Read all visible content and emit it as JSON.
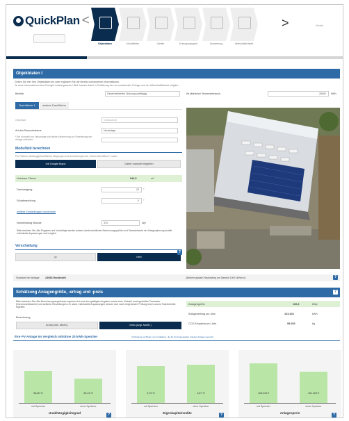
{
  "header": {
    "logo_bold": "QuickPlan",
    "logo_chevron": "<",
    "button_label": "",
    "steps": [
      {
        "label": "Objektdaten",
        "icon": "house-icon",
        "active": true
      },
      {
        "label": "Modulfelder",
        "icon": "roof-icon",
        "active": false
      },
      {
        "label": "Geräte",
        "icon": "calculator-icon",
        "active": false
      },
      {
        "label": "Erzeugungsgrad",
        "icon": "inverter-icon",
        "active": false
      },
      {
        "label": "Auswertung",
        "icon": "percent-icon",
        "active": false
      },
      {
        "label": "Wirtschaftlichkeit",
        "icon": "euro-icon",
        "active": false
      }
    ],
    "next_arrow": ">",
    "menu_text": "Weiter",
    "progress_fraction": 0.24
  },
  "objekt": {
    "title": "Objektdaten I",
    "intro_1": "Geben Sie hier Ihre Objektdaten ein oder ergänzen Sie die bereits vorhandenen Informationen.",
    "intro_2": "Ja ohne Informationen sind Energie-Leistungswerte / Bild- basiert dabei in Schätzung des zu erwartenden Ertrags und der Wirtschaftlichkeit möglich.",
    "betrieb_label": "Betrieb",
    "betrieb_value": "Gewerbebetrieb, Nutzung zweitägig",
    "verbrauch_label": "Ihr jährlicher Stromverbrauch",
    "verbrauch_value": "25000",
    "verbrauch_unit": "kWh",
    "tab_active": "Dachfläche 1",
    "tab_other": "weitere Dachfläche",
    "field_1_label": "Objektart",
    "field_1_value": "Gebäudeart",
    "field_2_label": "Art des Bauvorhabens",
    "field_2_value": "Neuanlage",
    "field_2_hint": "* Bei Auswahl von Neuanlage sind keine Abrechnung zur Erweiterung der Anlage enthalten",
    "modulfeld_title": "Modulfeld berechnen",
    "modulfeld_hint": "Für Flächen (abhängig/Dachfläche) Neigungen und Ausrichtungen der \"ersten Dachfläche\" nutzen",
    "btn_google": "mit Google Maps",
    "btn_manual": "Daten manuell eingeben",
    "nutzbare_label": "Nutzbare Fläche",
    "nutzbare_value": "543,5",
    "nutzbare_unit": "m²",
    "dachneigung_label": "Dachneigung",
    "dachneigung_value": "20",
    "dachneigung_unit": "°",
    "ausrichtung_label": "Südabweichung",
    "ausrichtung_value": "0",
    "ausrichtung_unit": "°",
    "link_advanced": "weitere Einstellungen vornehmen",
    "leistung_label": "Nennleistung Module",
    "leistung_value": "370",
    "leistung_unit": "Wp",
    "note": "Bitte beachten Sie: Alle Eingaben und Vorschläge werden anhand durchschnittlicher Berechnungsgrößen und Standardwerte der Anlagenplanung erstellt. Individuelle Anpassungen sind möglich.",
    "verschattung_title": "Verschattung",
    "vs_option_1": "ja",
    "vs_option_2": "nein",
    "standort_label": "Standort der Anlage",
    "standort_value": "24983 Handewitt",
    "standort_right": "Jährliche globale Einstrahlung am Standort 1000 kWh/m²/a"
  },
  "schaetzung": {
    "title": "Schätzung Anlagengröße, -ertrag und -preis",
    "text": "Bitte beachten Sie: Alle Berechnungsergebnisse ergeben sich aus den getätigten Angaben sowie einer Vielzahl voreingestellter Parameter (Durchschnittswerte) und weiteren Einstellungen z.B. stark. Individuelle Anpassungen können sich nach eingehender Prüfung durch unsere Fachbetriebe ergeben.",
    "berechnung_label": "Berechnung",
    "btn_1": "brutto (inkl. MwSt.)",
    "btn_2": "netto (zzgl. MwSt.)",
    "results": [
      {
        "label": "Anlagengröße",
        "value": "106,3",
        "unit": "kWp"
      },
      {
        "label": "Anlagenertrag pro Jahr",
        "value": "103.343",
        "unit": "kWh"
      },
      {
        "label": "CO2-Ersparnis pro Jahr",
        "value": "55.053",
        "unit": "kg"
      }
    ]
  },
  "vergleich": {
    "title": "Ihre PV-Anlage im Vergleich mit/ohne 20 kWh-Speicher",
    "subtitle": "(Vorhaltung auf Basis vom Installation, die für Sie freigestellten Anteilen Anlagen genutzt)",
    "panels": [
      {
        "title": "Unabhängigkeitsgrad",
        "bars": [
          {
            "label": "mit Speicher",
            "value": "65,80 %",
            "h": 0.75
          },
          {
            "label": "ohne Speicher",
            "value": "50,14 %",
            "h": 0.57
          }
        ]
      },
      {
        "title": "Eigenkapitalrendite",
        "bars": [
          {
            "label": "mit Speicher",
            "value": "3,75 %",
            "h": 0.86
          },
          {
            "label": "ohne Speicher",
            "value": "3,87 %",
            "h": 0.89
          }
        ]
      },
      {
        "title": "Anlagenpreis",
        "bars": [
          {
            "label": "mit Speicher",
            "value": "128.410 €",
            "h": 0.92
          },
          {
            "label": "ohne Speicher",
            "value": "101.420 €",
            "h": 0.72
          }
        ]
      }
    ]
  },
  "colors": {
    "navy": "#0a2c4e",
    "blue": "#2e6aa5",
    "green": "#b9e6a6",
    "light_green": "#dff1d5"
  }
}
